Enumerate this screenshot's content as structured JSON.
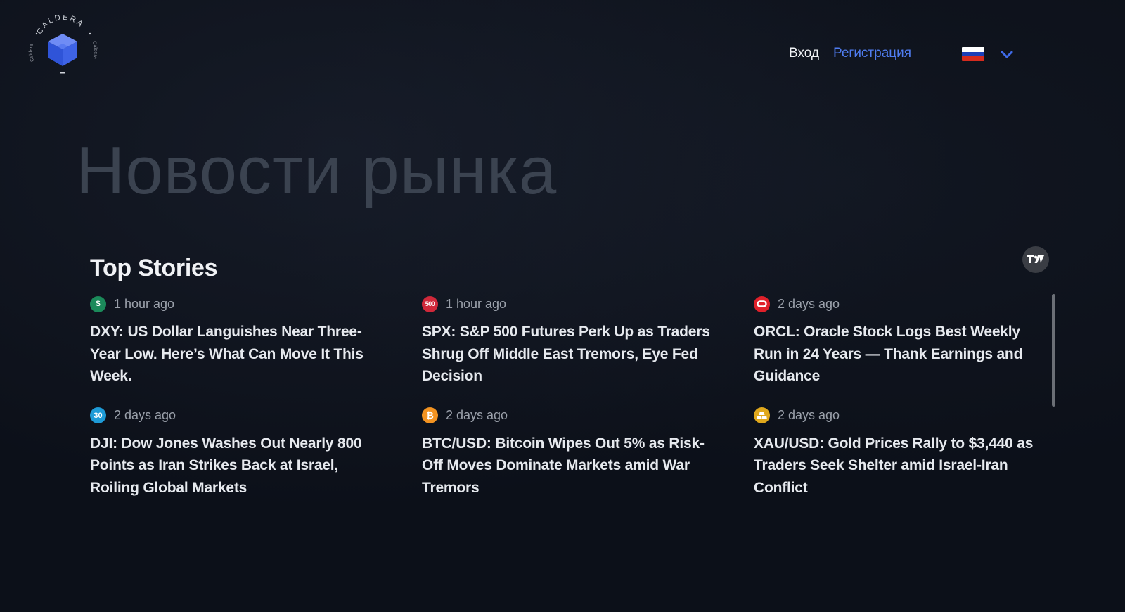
{
  "header": {
    "logo_text": "CALDERA",
    "logo_side_text": "Caldera",
    "login_label": "Вход",
    "register_label": "Регистрация",
    "language": {
      "selected": "ru",
      "flag_colors": [
        "#ffffff",
        "#1c3fb8",
        "#d52b1e"
      ]
    }
  },
  "hero": {
    "title": "Новости рынка"
  },
  "top_stories": {
    "title": "Top Stories",
    "badge_icon": "tradingview-logo-icon",
    "stories": [
      {
        "icon": "dollar-icon",
        "icon_text": "$",
        "icon_color": "#1b8a5a",
        "time": "1 hour ago",
        "headline": "DXY: US Dollar Languishes Near Three-Year Low. Here’s What Can Move It This Week."
      },
      {
        "icon": "sp500-icon",
        "icon_text": "500",
        "icon_color": "#d0283a",
        "time": "1 hour ago",
        "headline": "SPX: S&P 500 Futures Perk Up as Traders Shrug Off Middle East Tremors, Eye Fed Decision"
      },
      {
        "icon": "oracle-icon",
        "icon_text": "",
        "icon_color": "#e0202a",
        "time": "2 days ago",
        "headline": "ORCL: Oracle Stock Logs Best Weekly Run in 24 Years — Thank Earnings and Guidance"
      },
      {
        "icon": "dow-30-icon",
        "icon_text": "30",
        "icon_color": "#1e9bd7",
        "time": "2 days ago",
        "headline": "DJI: Dow Jones Washes Out Nearly 800 Points as Iran Strikes Back at Israel, Roiling Global Markets"
      },
      {
        "icon": "bitcoin-icon",
        "icon_text": "₿",
        "icon_color": "#f39321",
        "time": "2 days ago",
        "headline": "BTC/USD: Bitcoin Wipes Out 5% as Risk-Off Moves Dominate Markets amid War Tremors"
      },
      {
        "icon": "gold-bars-icon",
        "icon_text": "",
        "icon_color": "#e0a81c",
        "time": "2 days ago",
        "headline": "XAU/USD: Gold Prices Rally to $3,440 as Traders Seek Shelter amid Israel-Iran Conflict"
      }
    ]
  }
}
